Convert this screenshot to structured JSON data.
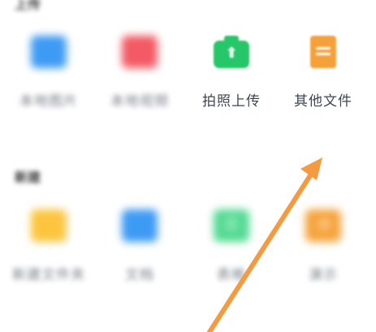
{
  "sections": {
    "upload": {
      "title": "上传"
    },
    "create": {
      "title": "新建"
    }
  },
  "upload_tiles": [
    {
      "label": "本地图片",
      "icon": "image-icon",
      "color": "#3d9bf4"
    },
    {
      "label": "本地视频",
      "icon": "video-icon",
      "color": "#f35a64"
    },
    {
      "label": "拍照上传",
      "icon": "camera-upload-icon",
      "color": "#26c768"
    },
    {
      "label": "其他文件",
      "icon": "document-icon",
      "color": "#f5a13a"
    }
  ],
  "create_tiles": [
    {
      "label": "新建文件夹",
      "icon": "folder-icon",
      "color": "#fdc53f"
    },
    {
      "label": "文档",
      "icon": "doc-icon",
      "color": "#3d9bf4"
    },
    {
      "label": "表格",
      "icon": "sheet-icon",
      "color": "#52da92"
    },
    {
      "label": "演示",
      "icon": "slides-icon",
      "color": "#f6a33b"
    }
  ],
  "annotation": {
    "icon": "pointer-arrow-icon",
    "color": "#f59a3e"
  }
}
